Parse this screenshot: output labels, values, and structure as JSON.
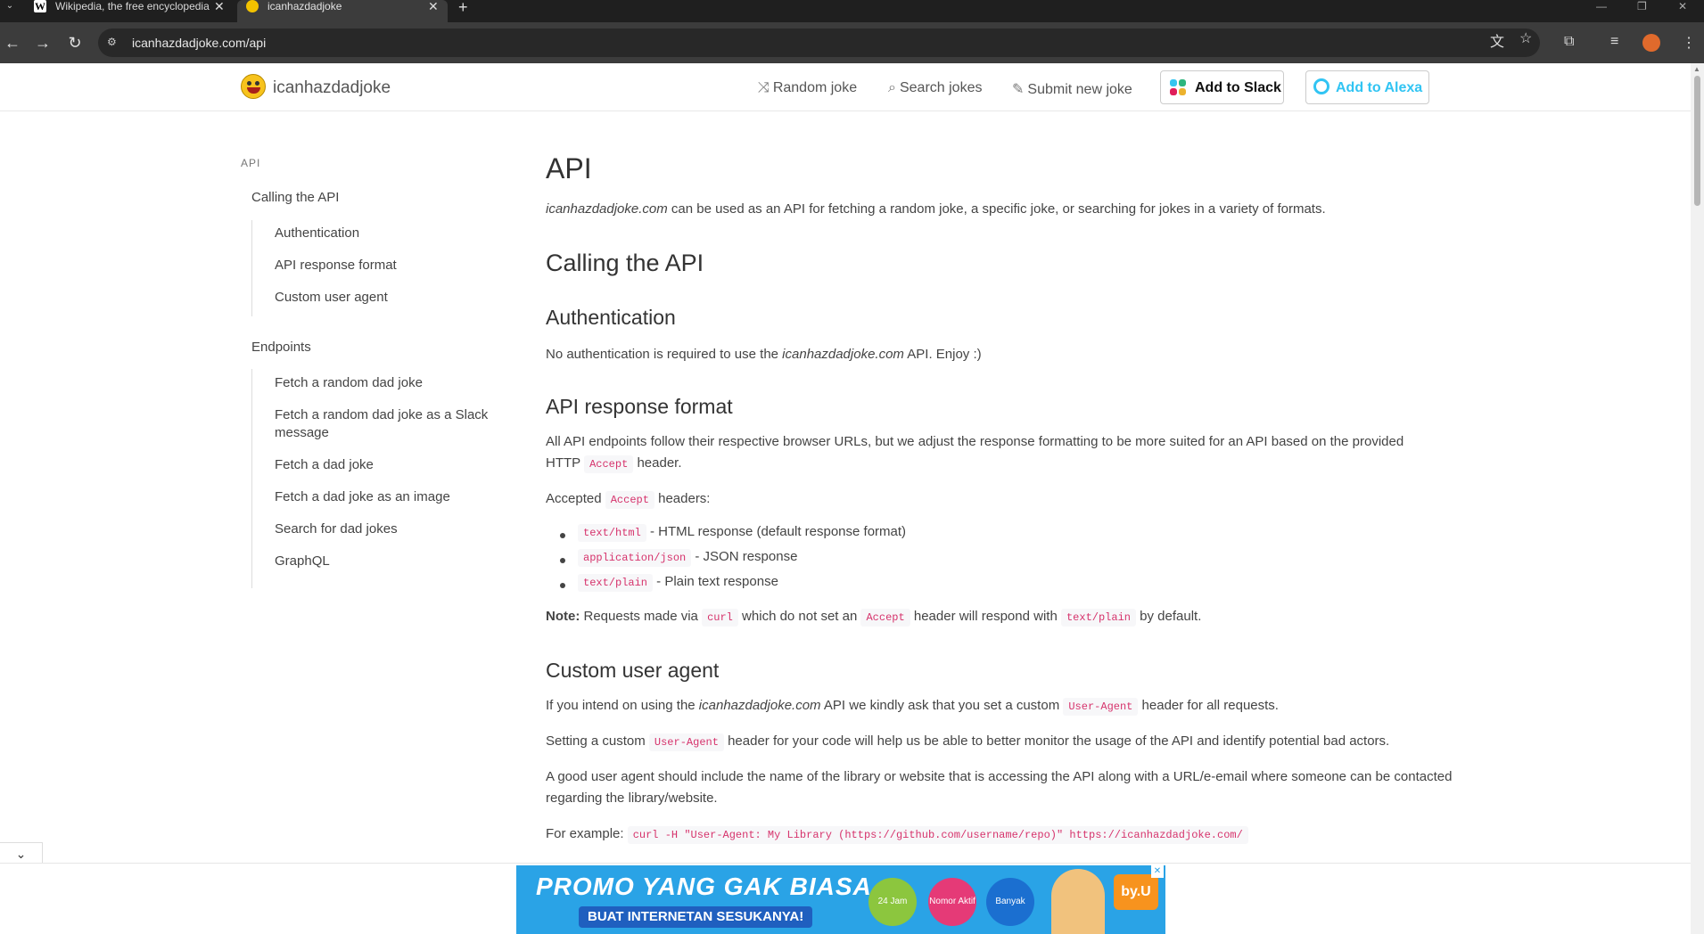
{
  "browser": {
    "tabs": [
      {
        "title": "Wikipedia, the free encyclopedia",
        "favicon": "W"
      },
      {
        "title": "icanhazdadjoke"
      }
    ],
    "url": "icanhazdadjoke.com/api"
  },
  "site": {
    "logo_text": "icanhazdadjoke",
    "nav": {
      "random": "Random joke",
      "search": "Search jokes",
      "submit": "Submit new joke",
      "slack": "Add to Slack",
      "alexa": "Add to Alexa"
    }
  },
  "sidebar": {
    "heading": "API",
    "section1": "Calling the API",
    "section1_items": [
      "Authentication",
      "API response format",
      "Custom user agent"
    ],
    "section2": "Endpoints",
    "section2_items": [
      "Fetch a random dad joke",
      "Fetch a random dad joke as a Slack message",
      "Fetch a dad joke",
      "Fetch a dad joke as an image",
      "Search for dad jokes",
      "GraphQL"
    ]
  },
  "content": {
    "title": "API",
    "intro_site": "icanhazdadjoke.com",
    "intro_rest": " can be used as an API for fetching a random joke, a specific joke, or searching for jokes in a variety of formats.",
    "calling_heading": "Calling the API",
    "auth_heading": "Authentication",
    "auth_pre": "No authentication is required to use the ",
    "auth_site": "icanhazdadjoke.com",
    "auth_post": " API. Enjoy :)",
    "format_heading": "API response format",
    "format_p1a": "All API endpoints follow their respective browser URLs, but we adjust the response formatting to be more suited for an API based on the provided",
    "format_p1b_pre": "HTTP ",
    "format_p1b_code": "Accept",
    "format_p1b_post": " header.",
    "accepted_pre": "Accepted ",
    "accepted_code": "Accept",
    "accepted_post": " headers:",
    "formats": [
      {
        "code": "text/html",
        "desc": " - HTML response (default response format)"
      },
      {
        "code": "application/json",
        "desc": " - JSON response"
      },
      {
        "code": "text/plain",
        "desc": " - Plain text response"
      }
    ],
    "note_label": "Note:",
    "note_a": " Requests made via ",
    "note_code1": "curl",
    "note_b": " which do not set an ",
    "note_code2": "Accept",
    "note_c": " header will respond with ",
    "note_code3": "text/plain",
    "note_d": " by default.",
    "ua_heading": "Custom user agent",
    "ua_p1_pre": "If you intend on using the ",
    "ua_p1_site": "icanhazdadjoke.com",
    "ua_p1_mid": " API we kindly ask that you set a custom ",
    "ua_p1_code": "User-Agent",
    "ua_p1_post": " header for all requests.",
    "ua_p2_pre": "Setting a custom ",
    "ua_p2_code": "User-Agent",
    "ua_p2_post": " header for your code will help us be able to better monitor the usage of the API and identify potential bad actors.",
    "ua_p3": "A good user agent should include the name of the library or website that is accessing the API along with a URL/e-email where someone can be contacted regarding the library/website.",
    "example_label": "For example: ",
    "example_code": "curl -H \"User-Agent: My Library (https://github.com/username/repo)\" https://icanhazdadjoke.com/"
  },
  "ad": {
    "headline": "PROMO YANG GAK BIASA",
    "subline": "BUAT INTERNETAN SESUKANYA!",
    "badge1": "24 Jam",
    "badge2": "Nomor Aktif",
    "badge3": "Banyak",
    "brand": "by.U"
  }
}
